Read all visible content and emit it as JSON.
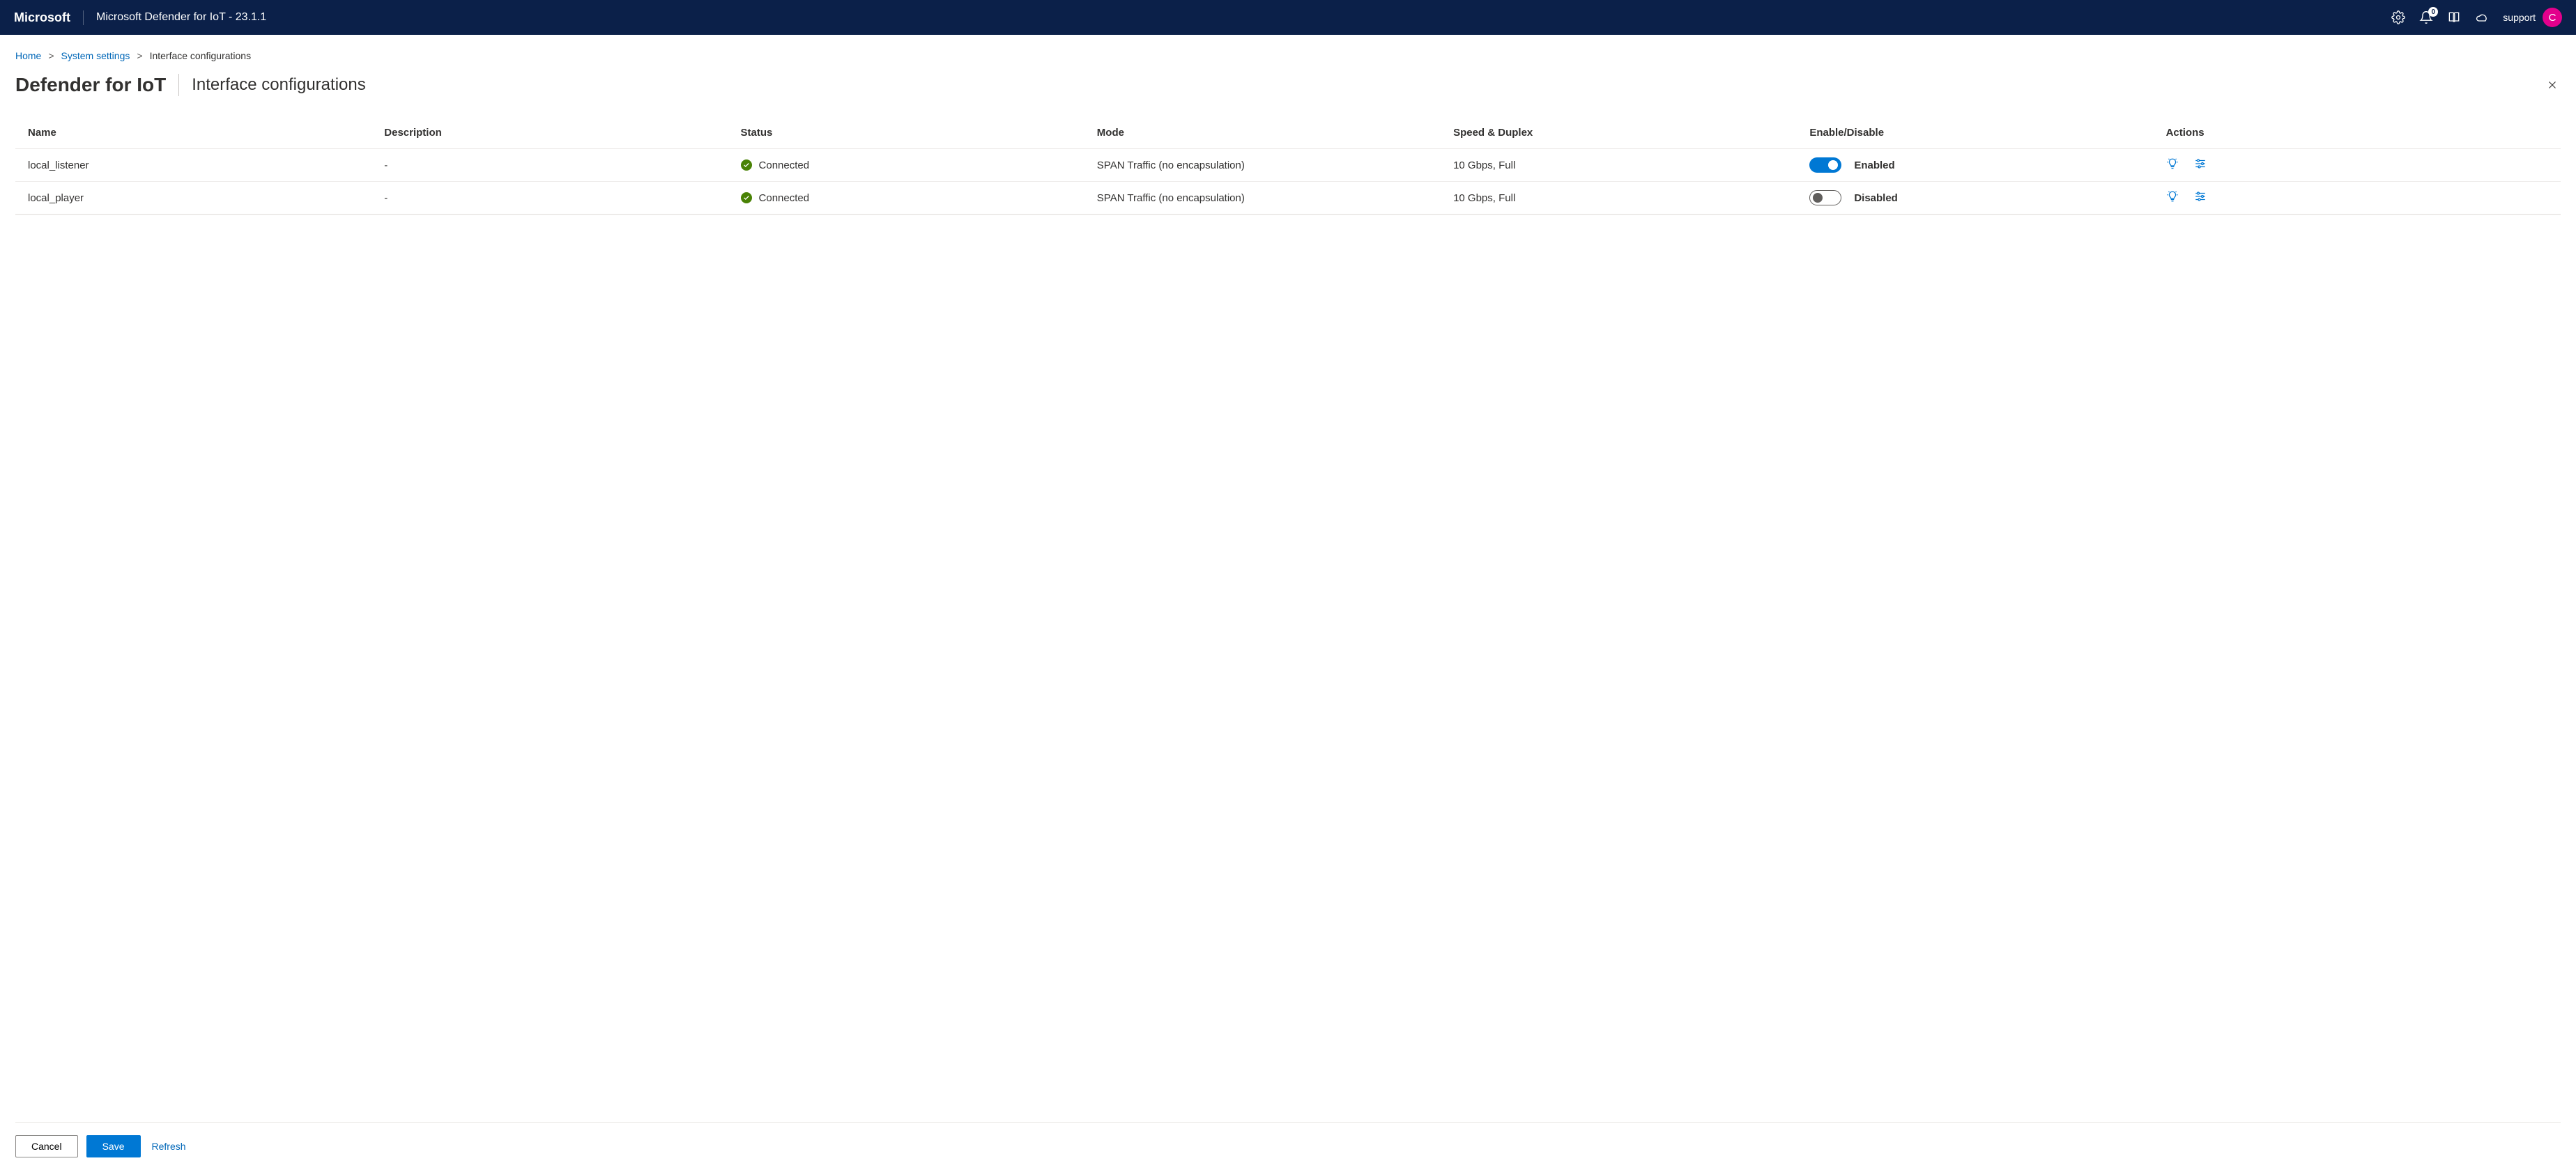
{
  "header": {
    "brand": "Microsoft",
    "app_title": "Microsoft Defender for IoT - 23.1.1",
    "notification_count": "0",
    "username": "support",
    "avatar_letter": "C"
  },
  "breadcrumb": {
    "home": "Home",
    "system_settings": "System settings",
    "current": "Interface configurations"
  },
  "page": {
    "title": "Defender for IoT",
    "subtitle": "Interface configurations"
  },
  "table": {
    "columns": {
      "name": "Name",
      "description": "Description",
      "status": "Status",
      "mode": "Mode",
      "speed": "Speed & Duplex",
      "enable": "Enable/Disable",
      "actions": "Actions"
    },
    "rows": [
      {
        "name": "local_listener",
        "description": "-",
        "status": "Connected",
        "mode": "SPAN Traffic (no encapsulation)",
        "speed": "10 Gbps, Full",
        "enabled": true,
        "enable_label": "Enabled"
      },
      {
        "name": "local_player",
        "description": "-",
        "status": "Connected",
        "mode": "SPAN Traffic (no encapsulation)",
        "speed": "10 Gbps, Full",
        "enabled": false,
        "enable_label": "Disabled"
      }
    ]
  },
  "footer": {
    "cancel": "Cancel",
    "save": "Save",
    "refresh": "Refresh"
  }
}
